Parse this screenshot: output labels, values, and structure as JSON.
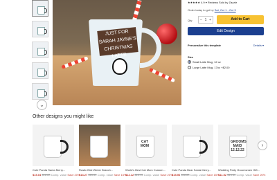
{
  "rating_line": "★★★★★ 4.9 ▾ Reviews  Sold by Zazzle",
  "shipping": {
    "prefix": "Order today to get by ",
    "link": "Sat, Oct 1 - Oct 3"
  },
  "quantity": {
    "label": "Qty:",
    "value": "1",
    "minus": "−",
    "plus": "+"
  },
  "add_to_cart": "Add to Cart",
  "edit_design": "Edit Design",
  "personalize": {
    "label": "Personalize this template",
    "details": "Details ▾"
  },
  "size": {
    "label": "Size",
    "options": [
      {
        "label": "Small Latte Mug, 12 oz",
        "selected": true
      },
      {
        "label": "Large Latte Mug, 17oz   +$2.00",
        "selected": false
      }
    ]
  },
  "hero": {
    "sign_text": "JUST FOR SARAH JAYNE'S CHRISTMAS LATTE"
  },
  "recommendations": {
    "title": "Other designs you might like",
    "items": [
      {
        "name": "Cute Panda Santa Merry...",
        "price": "$15.04",
        "was": "$18.80",
        "comm": "Comp. value",
        "save": "Save 20%",
        "mug": "white-black-handle",
        "text": ""
      },
      {
        "name": "Rustic Bird Winter Branch...",
        "price": "$13.27",
        "was": "$15.61",
        "comm": "Comp. value",
        "save": "Save 15%",
        "mug": "latte",
        "text": ""
      },
      {
        "name": "World's Best Cat Mom Custom...",
        "price": "$12.12",
        "was": "$15.15",
        "comm": "Comp. value",
        "save": "Save 20%",
        "mug": "white",
        "text": "CAT MOM"
      },
      {
        "name": "Cute Panda Bear Santa Merry...",
        "price": "$15.96",
        "was": "$18.80",
        "comm": "Comp. value",
        "save": "Save 15%",
        "mug": "white-black-handle",
        "text": ""
      },
      {
        "name": "Wedding Party Groomsmen Gift...",
        "price": "$11.52",
        "was": "$14.40",
        "comm": "Comp. value",
        "save": "Save 20%",
        "mug": "white",
        "text": "GROOMS MAID 12.12.22"
      }
    ]
  },
  "colors": {
    "accent": "#1b3f8f",
    "cart": "#f7c232",
    "sale": "#c0392b"
  },
  "icons": {
    "thumb_scroll": "chevron-down-icon",
    "carousel_next": "chevron-right-icon"
  }
}
